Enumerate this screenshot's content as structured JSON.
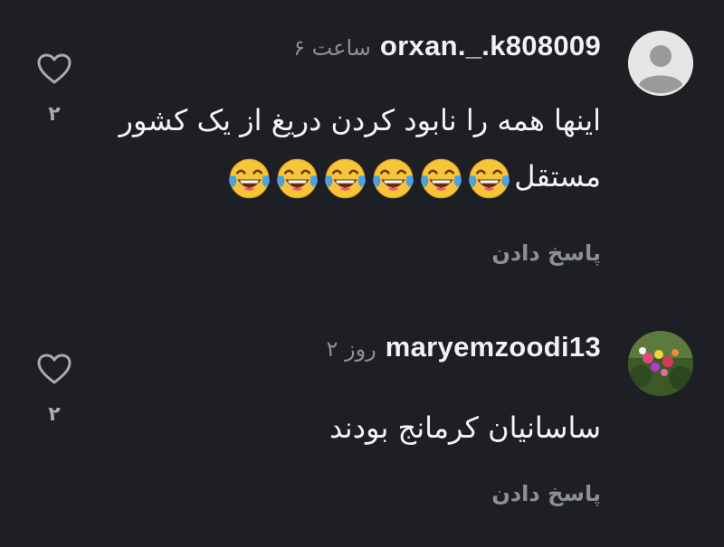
{
  "comments": [
    {
      "username": "orxan._.k808009",
      "timestamp": "۶ ساعت",
      "text": "اینها همه را نابود کردن دریغ از یک کشور مستقل",
      "emoji": [
        "face-with-tears-of-joy",
        "face-with-tears-of-joy",
        "face-with-tears-of-joy",
        "face-with-tears-of-joy",
        "face-with-tears-of-joy",
        "face-with-tears-of-joy"
      ],
      "reply_label": "پاسخ دادن",
      "like_count": "۲",
      "avatar": "default-avatar-icon"
    },
    {
      "username": "maryemzoodi13",
      "timestamp": "۲ روز",
      "text": "ساسانیان  کرمانج بودند",
      "reply_label": "پاسخ دادن",
      "like_count": "۲",
      "avatar": "flower-photo-avatar"
    }
  ],
  "colors": {
    "background": "#1e1f24",
    "username": "#f2f2f2",
    "text": "#f4f4f4",
    "muted": "#8d8f96",
    "emoji_yellow": "#f8c53a",
    "emoji_tear": "#4aa3df"
  }
}
